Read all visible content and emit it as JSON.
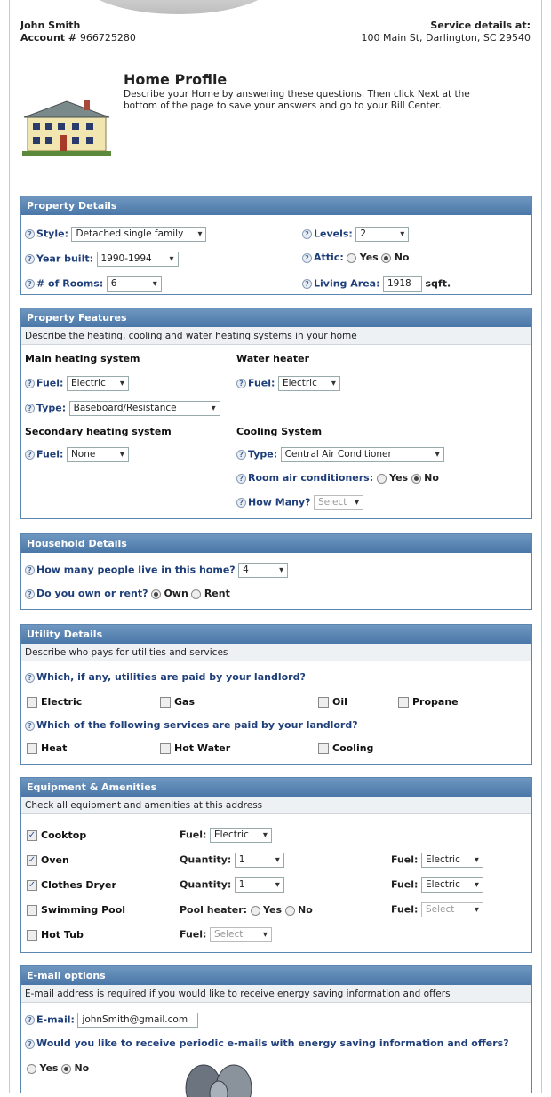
{
  "header": {
    "name": "John Smith",
    "account_label": "Account #",
    "account_number": "966725280",
    "service_label": "Service details at:",
    "service_address": "100 Main St, Darlington, SC 29540"
  },
  "profile": {
    "title": "Home Profile",
    "description": "Describe your Home by answering these questions. Then click Next at the bottom of the page to save your answers and go to your Bill Center."
  },
  "property_details": {
    "title": "Property Details",
    "style_label": "Style:",
    "style_value": "Detached single family",
    "levels_label": "Levels:",
    "levels_value": "2",
    "year_label": "Year built:",
    "year_value": "1990-1994",
    "attic_label": "Attic:",
    "yes": "Yes",
    "no": "No",
    "rooms_label": "# of Rooms:",
    "rooms_value": "6",
    "area_label": "Living Area:",
    "area_value": "1918",
    "area_unit": "sqft."
  },
  "property_features": {
    "title": "Property Features",
    "subtitle": "Describe the heating, cooling and water heating systems in your home",
    "main_heating": "Main heating system",
    "water_heater": "Water heater",
    "fuel_label": "Fuel:",
    "main_fuel": "Electric",
    "water_fuel": "Electric",
    "type_label": "Type:",
    "main_type": "Baseboard/Resistance",
    "secondary_heating": "Secondary heating system",
    "cooling_system": "Cooling System",
    "secondary_fuel": "None",
    "cooling_type": "Central Air Conditioner",
    "room_ac_label": "Room air conditioners:",
    "yes": "Yes",
    "no": "No",
    "how_many_label": "How Many?",
    "how_many_value": "Select"
  },
  "household": {
    "title": "Household Details",
    "people_label": "How many people live in this home?",
    "people_value": "4",
    "own_rent_label": "Do you own or rent?",
    "own": "Own",
    "rent": "Rent"
  },
  "utility": {
    "title": "Utility Details",
    "subtitle": "Describe who pays for utilities and services",
    "q1": "Which, if any, utilities are paid by your landlord?",
    "utilities": [
      "Electric",
      "Gas",
      "Oil",
      "Propane"
    ],
    "q2": "Which of the following services are paid by your landlord?",
    "services": [
      "Heat",
      "Hot Water",
      "Cooling"
    ]
  },
  "equipment": {
    "title": "Equipment & Amenities",
    "subtitle": "Check all equipment and amenities at this address",
    "cooktop": "Cooktop",
    "oven": "Oven",
    "dryer": "Clothes Dryer",
    "pool": "Swimming Pool",
    "hottub": "Hot Tub",
    "fuel_label": "Fuel:",
    "quantity_label": "Quantity:",
    "pool_heater_label": "Pool heater:",
    "yes": "Yes",
    "no": "No",
    "cooktop_fuel": "Electric",
    "oven_qty": "1",
    "oven_fuel": "Electric",
    "dryer_qty": "1",
    "dryer_fuel": "Electric",
    "pool_fuel": "Select",
    "hottub_fuel": "Select",
    "check_mark": "✓"
  },
  "email": {
    "title": "E-mail options",
    "subtitle": "E-mail address is required if you would like to receive energy saving information and offers",
    "email_label": "E-mail:",
    "email_value": "johnSmith@gmail.com",
    "question": "Would you like to receive periodic e-mails with energy saving information and offers?",
    "yes": "Yes",
    "no": "No"
  },
  "help_glyph": "?"
}
